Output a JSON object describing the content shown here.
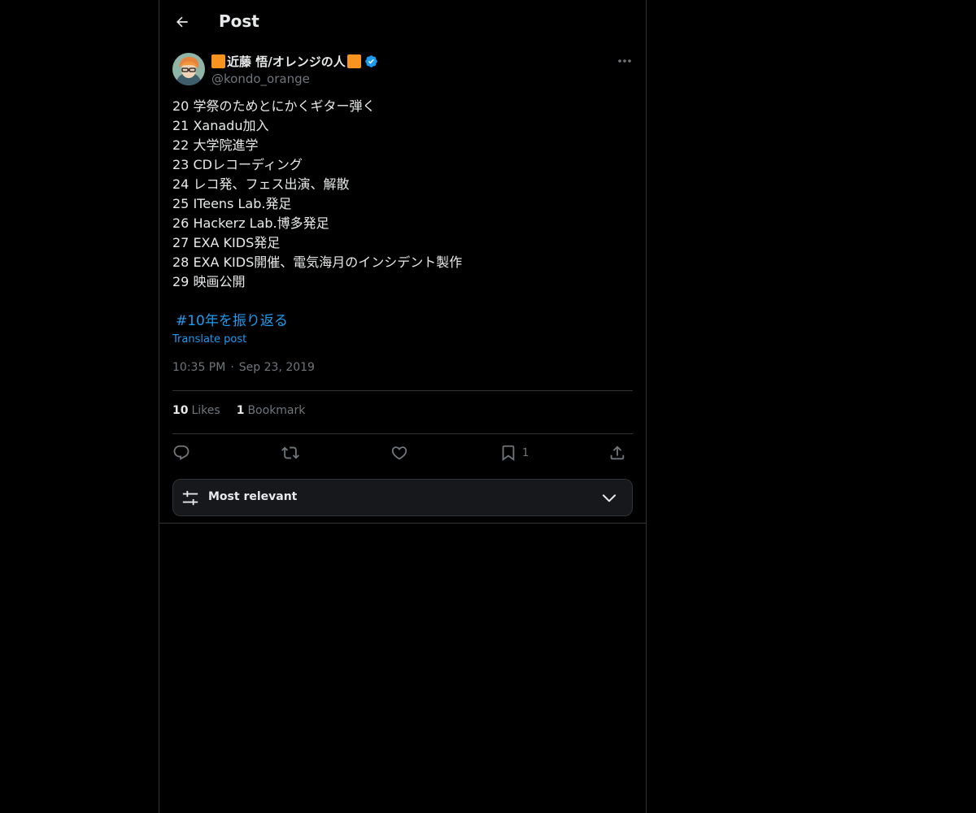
{
  "header": {
    "title": "Post",
    "back_icon": "arrow-left-icon"
  },
  "author": {
    "name_prefix_icon": "orange-square",
    "display_name": "近藤 悟/オレンジの人",
    "name_suffix_icon": "orange-square",
    "verified_icon": "verified-badge-icon",
    "handle": "@kondo_orange",
    "avatar_icon": "avatar-illustration"
  },
  "post": {
    "lines": [
      "20 学祭のためとにかくギター弾く",
      "21 Xanadu加入",
      "22 大学院進学",
      "23 CDレコーディング",
      "24 レコ発、フェス出演、解散",
      "25 ITeens Lab.発足",
      "26 Hackerz Lab.博多発足",
      "27 EXA KIDS発足",
      "28 EXA KIDS開催、電気海月のインシデント製作",
      "29 映画公開"
    ],
    "hashtag": "#10年を振り返る",
    "translate_label": "Translate post",
    "time": "10:35 PM",
    "separator": "·",
    "date": "Sep 23, 2019"
  },
  "stats": {
    "likes_count": "10",
    "likes_label": "Likes",
    "bookmarks_count": "1",
    "bookmarks_label": "Bookmark"
  },
  "actions": {
    "reply_icon": "reply-icon",
    "repost_icon": "repost-icon",
    "like_icon": "heart-icon",
    "bookmark_icon": "bookmark-icon",
    "bookmark_count": "1",
    "share_icon": "share-icon"
  },
  "sort": {
    "label": "Most relevant",
    "icon": "sliders-icon",
    "chevron": "chevron-down-icon"
  },
  "colors": {
    "background": "#000000",
    "text": "#e7e9ea",
    "muted": "#71767b",
    "accent": "#1d9bf0",
    "border": "#2f3336",
    "orange": "#f7931e"
  }
}
